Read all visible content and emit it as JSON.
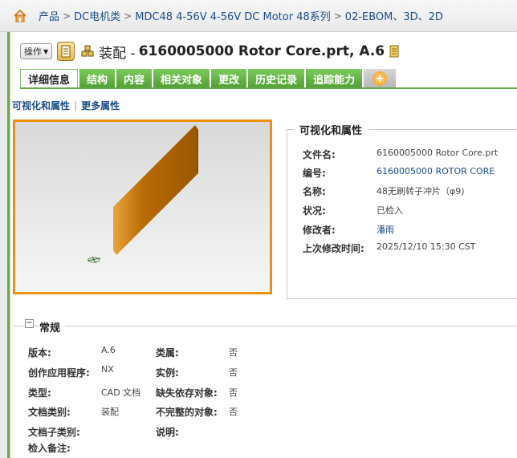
{
  "breadcrumb": {
    "items": [
      "产品",
      "DC电机类",
      "MDC48 4-56V 4-56V DC Motor 48系列",
      "02-EBOM、3D、2D"
    ],
    "separator": ">"
  },
  "header": {
    "actions_label": "操作",
    "title_prefix": "装配 -",
    "title": "6160005000 Rotor Core.prt, A.6"
  },
  "tabs": [
    "详细信息",
    "结构",
    "内容",
    "相关对象",
    "更改",
    "历史记录",
    "追踪能力"
  ],
  "active_tab": "详细信息",
  "tab_plus_symbol": "+",
  "subnav": {
    "link1": "可视化和属性",
    "separator": "|",
    "link2": "更多属性"
  },
  "visual_props": {
    "title": "可视化和属性",
    "rows": [
      {
        "label": "文件名:",
        "value": "6160005000 Rotor Core.prt"
      },
      {
        "label": "编号:",
        "value": "6160005000 ROTOR CORE"
      },
      {
        "label": "名称:",
        "value": "48无刷转子冲片（φ9)"
      },
      {
        "label": "状况:",
        "value": "已检入"
      },
      {
        "label": "修改者:",
        "value": "潘雨"
      },
      {
        "label": "上次修改时间:",
        "value": "2025/12/10 15:30 CST"
      }
    ]
  },
  "general": {
    "collapse_symbol": "−",
    "title": "常规",
    "left": [
      {
        "label": "版本:",
        "value": "A.6"
      },
      {
        "label": "创作应用程序:",
        "value": "NX"
      },
      {
        "label": "类型:",
        "value": "CAD 文档"
      },
      {
        "label": "文档类别:",
        "value": "装配"
      },
      {
        "label": "文档子类别:",
        "value": ""
      },
      {
        "label": "检入备注:",
        "value": ""
      }
    ],
    "right": [
      {
        "label": "类属:",
        "value": "否"
      },
      {
        "label": "实例:",
        "value": "否"
      },
      {
        "label": "缺失依存对象:",
        "value": "否"
      },
      {
        "label": "不完整的对象:",
        "value": "否"
      },
      {
        "label": "说明:",
        "value": ""
      }
    ]
  },
  "colors": {
    "tab_green": "#5cab3c",
    "link_blue": "#1a4e8a",
    "viewer_border": "#f0900a"
  }
}
